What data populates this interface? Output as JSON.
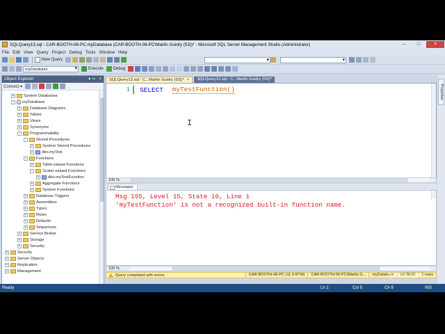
{
  "window": {
    "title": "SQLQuery13.sql - CAR-BOOTH-06-PC.myDatabase (CAR-BOOTH-06-PC\\Martin Guidry (53))* - Microsoft SQL Server Management Studio (Administrator)"
  },
  "menu": [
    "File",
    "Edit",
    "View",
    "Query",
    "Project",
    "Debug",
    "Tools",
    "Window",
    "Help"
  ],
  "toolbar": {
    "new_query": "New Query",
    "database": "myDatabase",
    "execute": "Execute",
    "debug": "Debug"
  },
  "object_explorer": {
    "title": "Object Explorer",
    "connect": "Connect ▾",
    "tree": [
      {
        "label": "System Databases",
        "depth": 2,
        "exp": "+",
        "icon": "folder"
      },
      {
        "label": "myDatabase",
        "depth": 2,
        "exp": "-",
        "icon": "db"
      },
      {
        "label": "Database Diagrams",
        "depth": 3,
        "exp": "+",
        "icon": "folder"
      },
      {
        "label": "Tables",
        "depth": 3,
        "exp": "+",
        "icon": "folder"
      },
      {
        "label": "Views",
        "depth": 3,
        "exp": "+",
        "icon": "folder"
      },
      {
        "label": "Synonyms",
        "depth": 3,
        "exp": "+",
        "icon": "folder"
      },
      {
        "label": "Programmability",
        "depth": 3,
        "exp": "-",
        "icon": "folder"
      },
      {
        "label": "Stored Procedures",
        "depth": 4,
        "exp": "-",
        "icon": "folder"
      },
      {
        "label": "System Stored Procedures",
        "depth": 5,
        "exp": "+",
        "icon": "folder"
      },
      {
        "label": "dbo.myTest",
        "depth": 5,
        "exp": "+",
        "icon": "fn"
      },
      {
        "label": "Functions",
        "depth": 4,
        "exp": "-",
        "icon": "folder"
      },
      {
        "label": "Table-valued Functions",
        "depth": 5,
        "exp": "+",
        "icon": "folder"
      },
      {
        "label": "Scalar-valued Functions",
        "depth": 5,
        "exp": "-",
        "icon": "folder"
      },
      {
        "label": "dbo.myTestFunction",
        "depth": 6,
        "exp": "+",
        "icon": "fn"
      },
      {
        "label": "Aggregate Functions",
        "depth": 5,
        "exp": "+",
        "icon": "folder"
      },
      {
        "label": "System Functions",
        "depth": 5,
        "exp": "+",
        "icon": "folder"
      },
      {
        "label": "Database Triggers",
        "depth": 4,
        "exp": "+",
        "icon": "folder"
      },
      {
        "label": "Assemblies",
        "depth": 4,
        "exp": "+",
        "icon": "folder"
      },
      {
        "label": "Types",
        "depth": 4,
        "exp": "+",
        "icon": "folder"
      },
      {
        "label": "Rules",
        "depth": 4,
        "exp": "+",
        "icon": "folder"
      },
      {
        "label": "Defaults",
        "depth": 4,
        "exp": "+",
        "icon": "folder"
      },
      {
        "label": "Sequences",
        "depth": 4,
        "exp": "+",
        "icon": "folder"
      },
      {
        "label": "Service Broker",
        "depth": 3,
        "exp": "+",
        "icon": "folder"
      },
      {
        "label": "Storage",
        "depth": 3,
        "exp": "+",
        "icon": "folder"
      },
      {
        "label": "Security",
        "depth": 3,
        "exp": "+",
        "icon": "folder"
      },
      {
        "label": "Security",
        "depth": 1,
        "exp": "+",
        "icon": "folder"
      },
      {
        "label": "Server Objects",
        "depth": 1,
        "exp": "+",
        "icon": "folder"
      },
      {
        "label": "Replication",
        "depth": 1,
        "exp": "+",
        "icon": "folder"
      },
      {
        "label": "Management",
        "depth": 1,
        "exp": "+",
        "icon": "folder"
      }
    ]
  },
  "tabs": [
    {
      "label": "SQLQuery13.sql - C...Martin Guidry (53))*",
      "close": "×",
      "active": true
    },
    {
      "label": "SQLQuery12.sql - C...Martin Guidry (54))*",
      "close": "",
      "active": false
    }
  ],
  "editor": {
    "line_number": "1",
    "keyword": "SELECT",
    "function": "myTestFunction()"
  },
  "zoom": {
    "editor": "100 %",
    "results": "100 %"
  },
  "results": {
    "tab": "Messages",
    "lines": [
      "Msg 195, Level 15, State 10, Line 1",
      "'myTestFunction' is not a recognized built-in function name."
    ]
  },
  "query_status": {
    "message": "Query completed with errors.",
    "server": "CAR-BOOTH-06-PC (11.0 RTM)",
    "user": "CAR-BOOTH-06-PC\\Martin G...",
    "database": "myDatabase",
    "time": "00:00:00",
    "rows": "0 rows"
  },
  "statusbar": {
    "ready": "Ready",
    "ln": "Ln 1",
    "col": "Col 9",
    "ch": "Ch 9",
    "ins": "INS"
  },
  "right_rail": {
    "properties": "Properties"
  },
  "watermark": "lynda.com",
  "colors": {
    "keyword": "#0000ff",
    "function": "#c86400",
    "error": "#e0151c",
    "statusbar": "#1f4d83"
  }
}
